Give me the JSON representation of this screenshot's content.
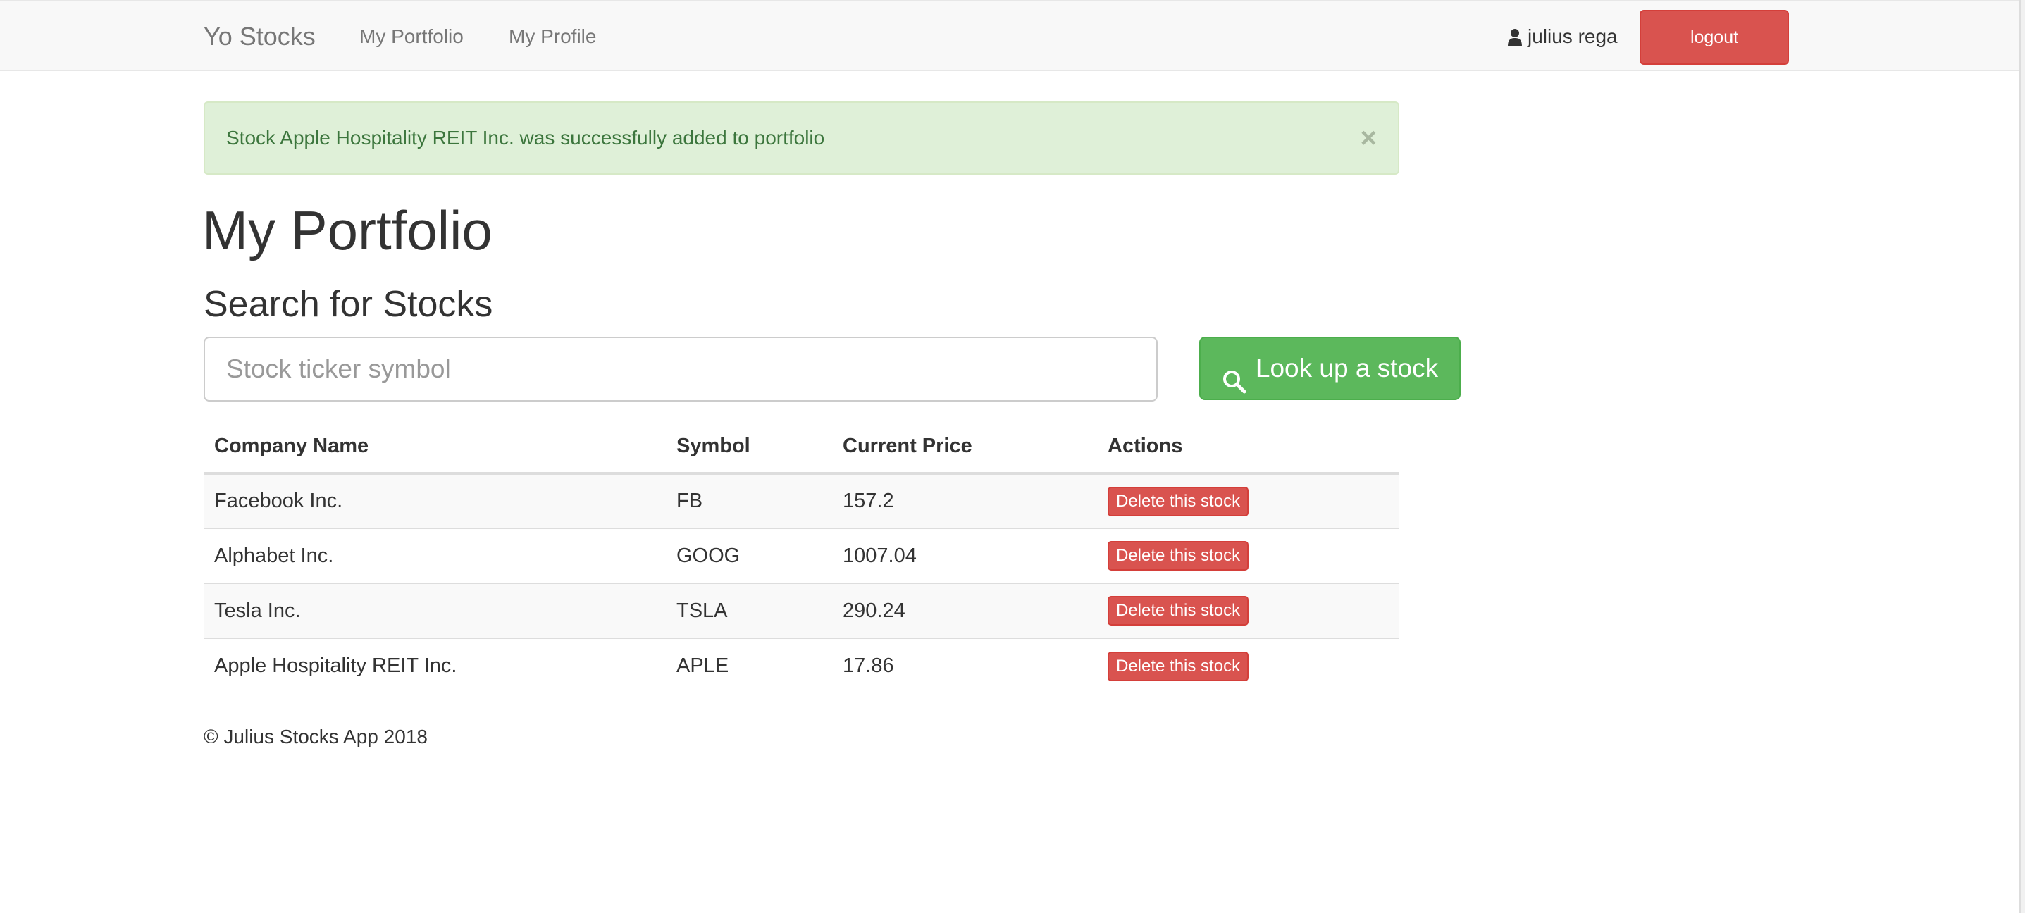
{
  "navbar": {
    "brand": "Yo Stocks",
    "links": [
      {
        "label": "My Portfolio"
      },
      {
        "label": "My Profile"
      }
    ],
    "user_name": "julius rega",
    "user_icon": "user-icon",
    "logout_label": "logout"
  },
  "alert": {
    "message": "Stock Apple Hospitality REIT Inc. was successfully added to portfolio",
    "close_symbol": "×",
    "background": "#dff0d8",
    "text_color": "#3c763d"
  },
  "page": {
    "title": "My Portfolio",
    "search_heading": "Search for Stocks"
  },
  "search": {
    "placeholder": "Stock ticker symbol",
    "value": "",
    "button_label": "Look up a stock",
    "button_icon": "search-icon",
    "button_color": "#5cb85c"
  },
  "table": {
    "headers": [
      "Company Name",
      "Symbol",
      "Current Price",
      "Actions"
    ],
    "rows": [
      {
        "company": "Facebook Inc.",
        "symbol": "FB",
        "price": "157.2",
        "action": "Delete this stock"
      },
      {
        "company": "Alphabet Inc.",
        "symbol": "GOOG",
        "price": "1007.04",
        "action": "Delete this stock"
      },
      {
        "company": "Tesla Inc.",
        "symbol": "TSLA",
        "price": "290.24",
        "action": "Delete this stock"
      },
      {
        "company": "Apple Hospitality REIT Inc.",
        "symbol": "APLE",
        "price": "17.86",
        "action": "Delete this stock"
      }
    ],
    "danger_color": "#d9534f"
  },
  "footer": {
    "text": "© Julius Stocks App 2018"
  }
}
